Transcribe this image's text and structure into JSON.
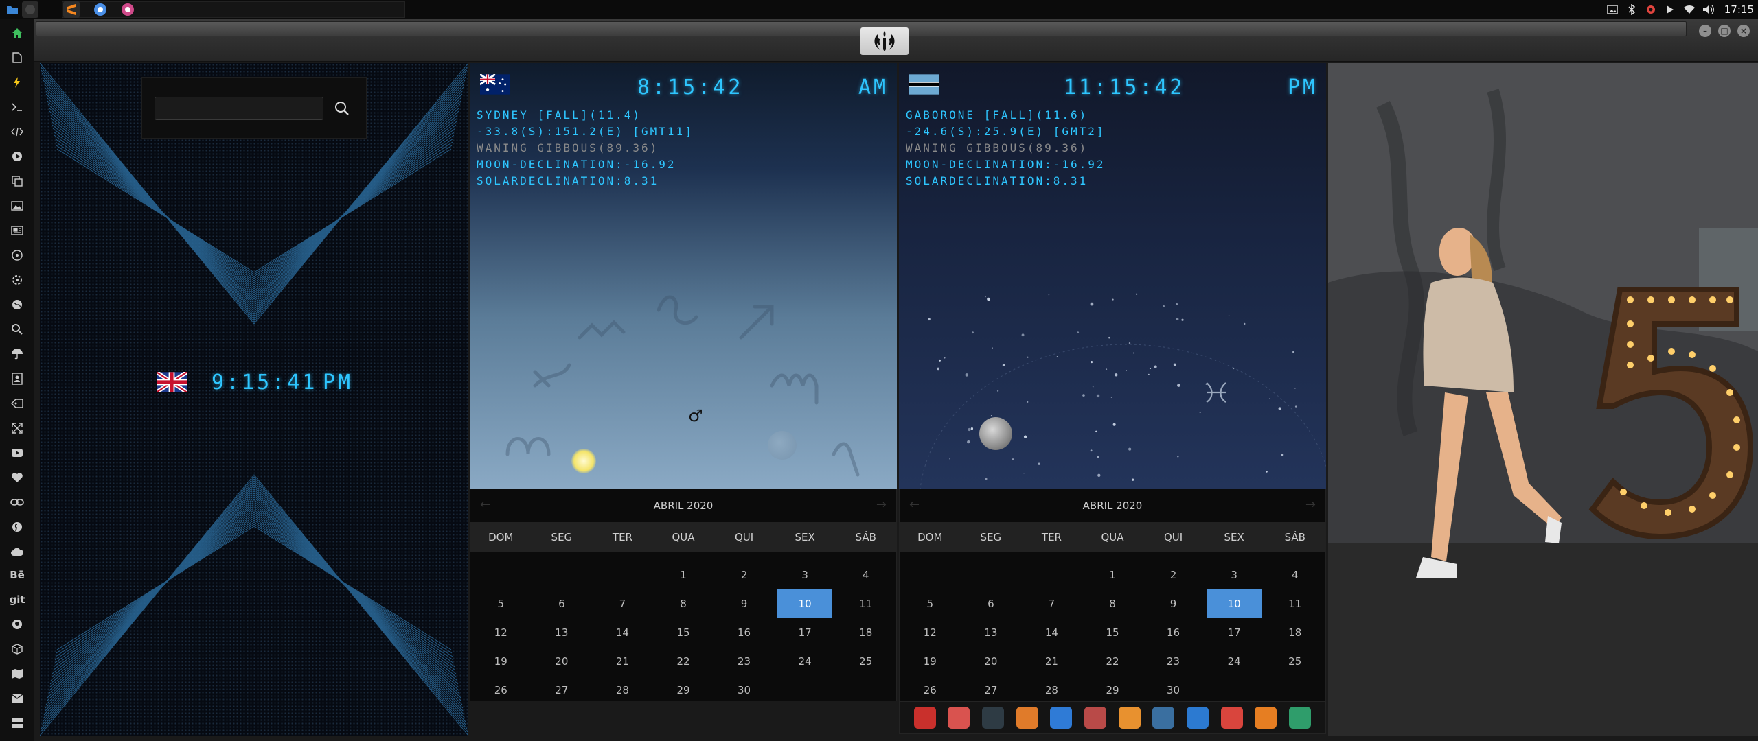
{
  "taskbar": {
    "apps": [
      {
        "icon": "files-icon",
        "color": "#3b86d6"
      },
      {
        "icon": "terminal-icon",
        "color": "#555555"
      },
      {
        "icon": "sublime-text-icon",
        "color": "#f5871f"
      },
      {
        "icon": "chromium-icon",
        "color": "#4a8fe7"
      },
      {
        "icon": "rebel-app-icon",
        "color": "#d04a8a"
      }
    ],
    "clock": "17:15"
  },
  "window": {
    "title_icon": "rebel-alliance-icon"
  },
  "world_clock": {
    "search_placeholder": "",
    "flag": "uk-flag-icon",
    "time": "9:15:41",
    "ampm": "PM"
  },
  "sydney": {
    "flag": "australia-flag-icon",
    "time": "8:15:42",
    "ampm": "AM",
    "lines": [
      "SYDNEY [FALL](11.4)",
      "-33.8(S):151.2(E) [GMT11]",
      "WANING GIBBOUS(89.36)",
      "MOON-DECLINATION:-16.92",
      "SOLARDECLINATION:8.31"
    ],
    "mars_symbol": "♂"
  },
  "gaborone": {
    "flag": "botswana-flag-icon",
    "time": "11:15:42",
    "ampm": "PM",
    "lines": [
      "GABORONE [FALL](11.6)",
      "-24.6(S):25.9(E) [GMT2]",
      "WANING GIBBOUS(89.36)",
      "MOON-DECLINATION:-16.92",
      "SOLARDECLINATION:8.31"
    ]
  },
  "calendar": {
    "month": "ABRIL 2020",
    "days_of_week": [
      "DOM",
      "SEG",
      "TER",
      "QUA",
      "QUI",
      "SEX",
      "SÁB"
    ],
    "leading_blanks": 3,
    "days": [
      "1",
      "2",
      "3",
      "4",
      "5",
      "6",
      "7",
      "8",
      "9",
      "10",
      "11",
      "12",
      "13",
      "14",
      "15",
      "16",
      "17",
      "18",
      "19",
      "20",
      "21",
      "22",
      "23",
      "24",
      "25",
      "26",
      "27",
      "28",
      "29",
      "30"
    ],
    "today": "10"
  },
  "bottom_dock": [
    {
      "icon": "acrobat-icon",
      "color": "#c9302c"
    },
    {
      "icon": "hourglass-icon",
      "color": "#d9534f"
    },
    {
      "icon": "globe-dark-icon",
      "color": "#2e3b44"
    },
    {
      "icon": "image-viewer-icon",
      "color": "#e07b2a"
    },
    {
      "icon": "translate-icon",
      "color": "#2f7bd6"
    },
    {
      "icon": "notes-icon",
      "color": "#b94a48"
    },
    {
      "icon": "search-app-icon",
      "color": "#e8912f"
    },
    {
      "icon": "clock-app-icon",
      "color": "#3a6fa0"
    },
    {
      "icon": "web-browser-icon",
      "color": "#2c7ad1"
    },
    {
      "icon": "calendar-app-icon",
      "color": "#d9453d"
    },
    {
      "icon": "arrow-app-icon",
      "color": "#e67e22"
    },
    {
      "icon": "yandex-icon",
      "color": "#2f9d6b"
    }
  ],
  "left_dock": [
    "home-icon",
    "document-icon",
    "bolt-icon",
    "terminal-icon",
    "code-icon",
    "play-icon",
    "copy-icon",
    "image-icon",
    "news-icon",
    "atom-icon",
    "settings-icon",
    "globe-icon",
    "search-icon",
    "umbrella-icon",
    "contact-icon",
    "tag-icon",
    "expand-icon",
    "youtube-icon",
    "heart-icon",
    "link-icon",
    "pinterest-icon",
    "cloud-icon",
    "behance-icon",
    "git-icon",
    "github-icon",
    "package-icon",
    "map-icon",
    "mail-icon",
    "storage-icon"
  ],
  "left_dock_labels": {
    "behance": "Bē",
    "git": "git"
  }
}
